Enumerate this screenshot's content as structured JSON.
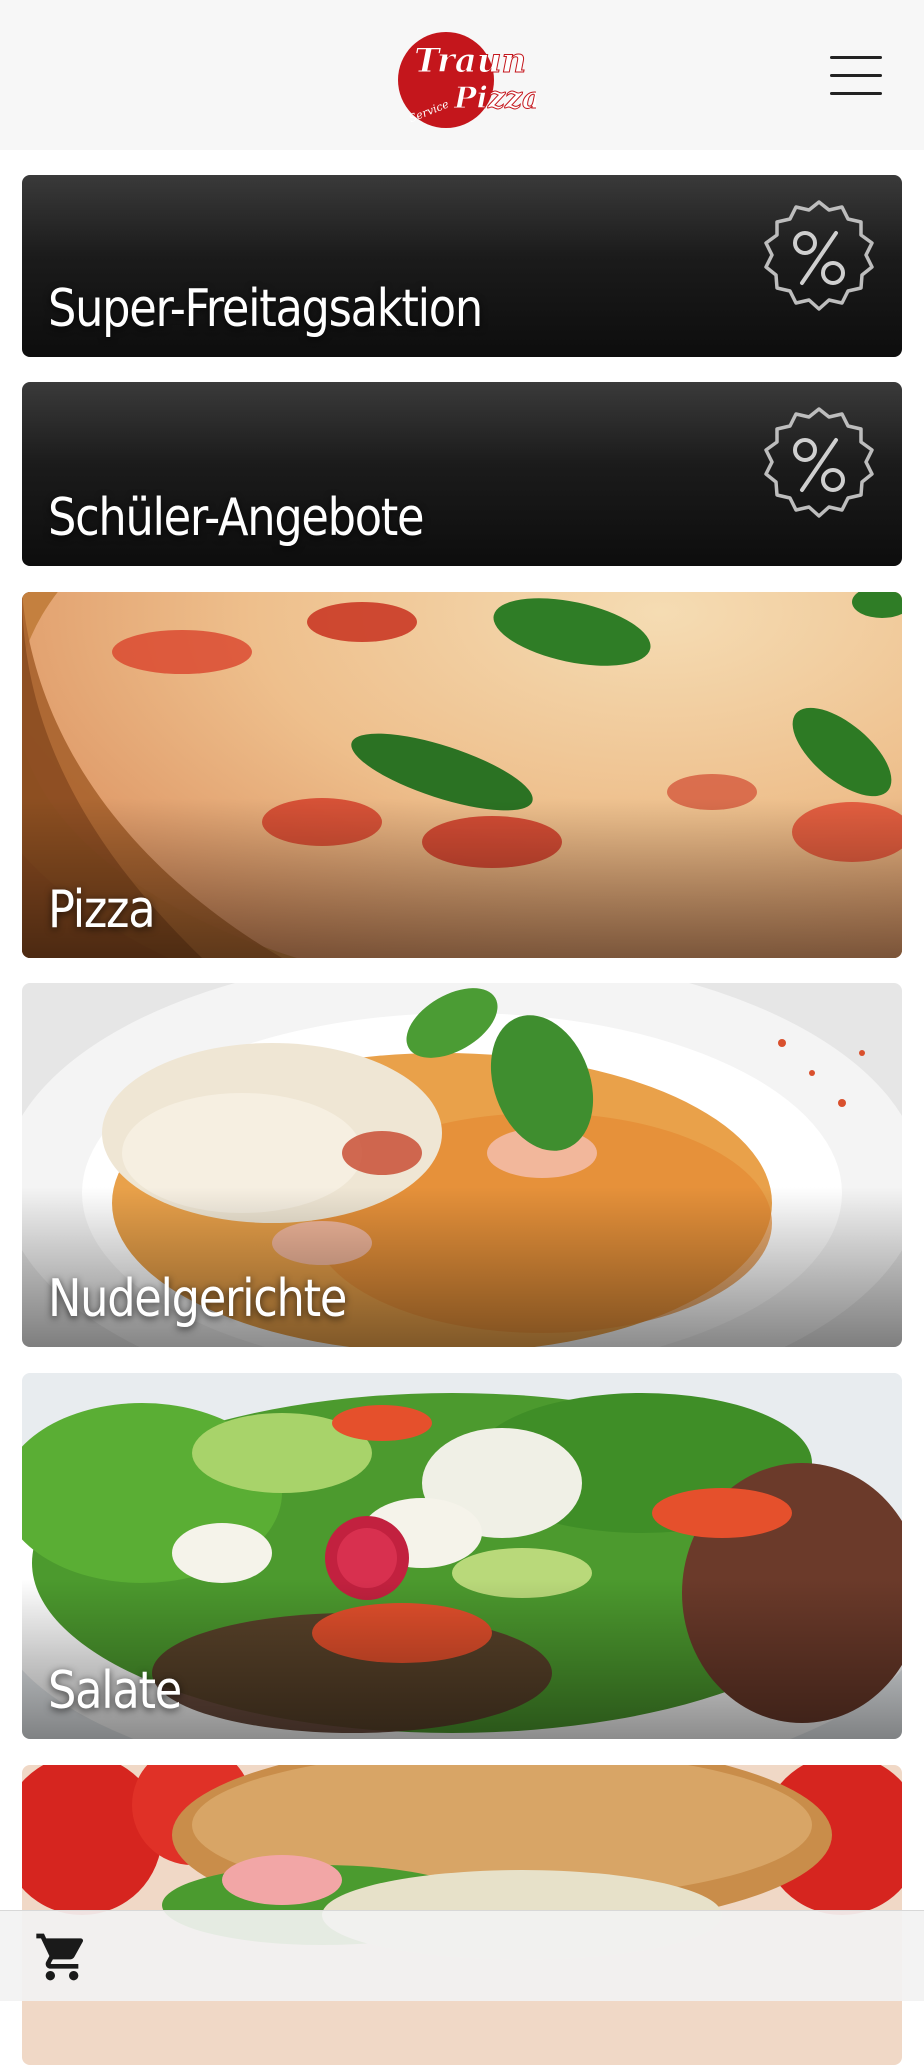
{
  "header": {
    "logo_text_top": "Traun",
    "logo_text_bottom": "Pizza",
    "logo_text_small": "Service",
    "menu_icon": "hamburger-menu-icon"
  },
  "categories": [
    {
      "label": "Super-Freitagsaktion",
      "kind": "promo",
      "icon": "percent-badge-icon"
    },
    {
      "label": "Schüler-Angebote",
      "kind": "promo",
      "icon": "percent-badge-icon"
    },
    {
      "label": "Pizza",
      "kind": "photo"
    },
    {
      "label": "Nudelgerichte",
      "kind": "photo"
    },
    {
      "label": "Salate",
      "kind": "photo"
    },
    {
      "label": "",
      "kind": "photo"
    }
  ],
  "footer": {
    "cart_icon": "shopping-cart-icon"
  },
  "colors": {
    "brand_red": "#c4161c",
    "header_bg": "#f7f7f7",
    "promo_bg": "#111111"
  }
}
